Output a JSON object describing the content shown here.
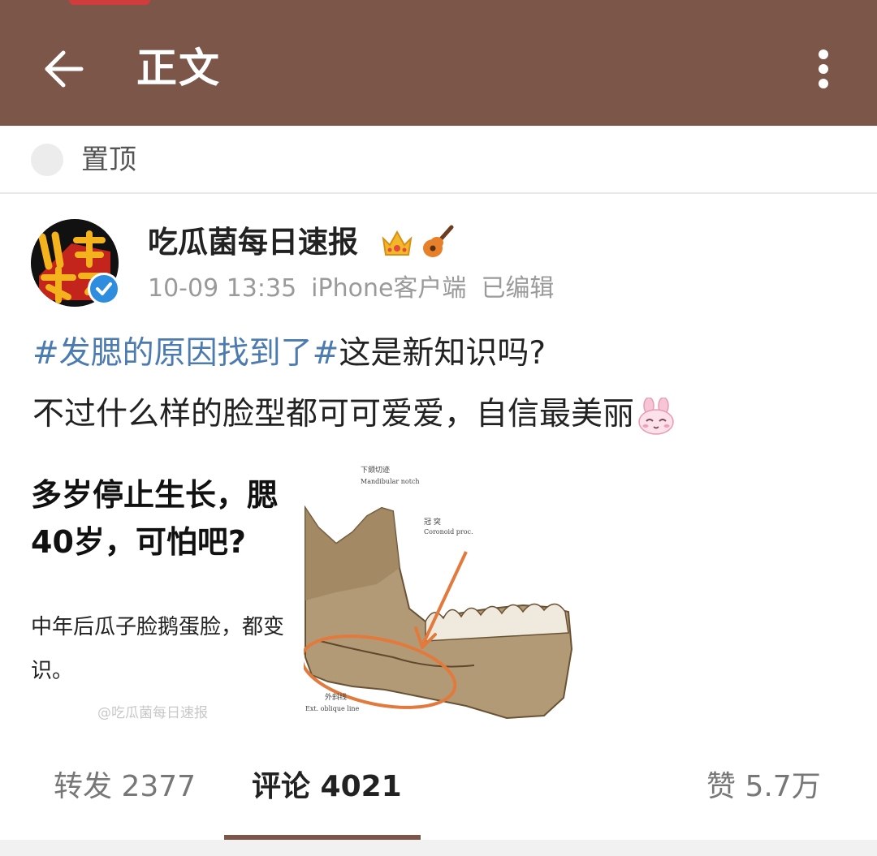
{
  "header": {
    "title": "正文",
    "back_icon": "arrow-left-icon",
    "menu_icon": "more-vertical-icon",
    "background_color": "#7b5649"
  },
  "pin": {
    "label": "置顶"
  },
  "post": {
    "author": "吃瓜菌每日速报",
    "timestamp": "10-09 13:35",
    "client": "iPhone客户端",
    "edited": "已编辑",
    "hashtag": "#发腮的原因找到了#",
    "text1": "这是新知识吗?",
    "text2": "不过什么样的脸型都可可爱爱，自信最美丽",
    "hashtag_color": "#4b7bb0",
    "image": {
      "line1": "多岁停止生长，腮",
      "line2": "40岁，可怕吧?",
      "line3": "中年后瓜子脸鹅蛋脸，都变",
      "line4": "识。",
      "watermark": "@吃瓜菌每日速报"
    }
  },
  "tabs": {
    "repost": "转发 2377",
    "comment": "评论 4021",
    "like": "赞 5.7万",
    "active": "comment"
  }
}
